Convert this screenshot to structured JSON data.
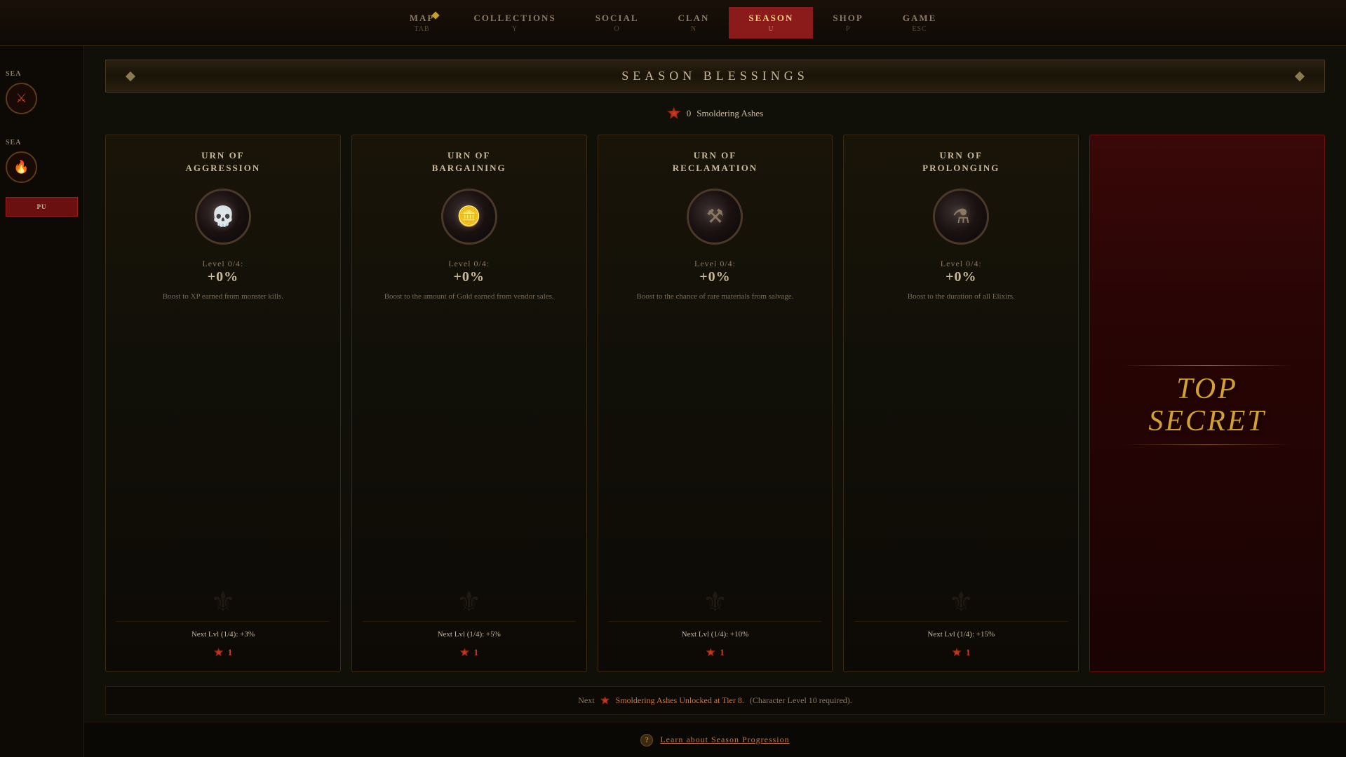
{
  "nav": {
    "items": [
      {
        "id": "map",
        "label": "MAP",
        "key": "TAB",
        "active": false,
        "hasDiamond": true
      },
      {
        "id": "collections",
        "label": "COLLECTIONS",
        "key": "Y",
        "active": false,
        "hasDiamond": false
      },
      {
        "id": "social",
        "label": "SOCIAL",
        "key": "O",
        "active": false,
        "hasDiamond": false
      },
      {
        "id": "clan",
        "label": "CLAN",
        "key": "N",
        "active": false,
        "hasDiamond": false
      },
      {
        "id": "season",
        "label": "SEASON",
        "key": "U",
        "active": true,
        "hasDiamond": false
      },
      {
        "id": "shop",
        "label": "SHOP",
        "key": "P",
        "active": false,
        "hasDiamond": false
      },
      {
        "id": "game",
        "label": "GAME",
        "key": "ESC",
        "active": false,
        "hasDiamond": false
      }
    ]
  },
  "panel": {
    "title": "SEASON BLESSINGS",
    "ashes_count": "0",
    "ashes_label": "Smoldering Ashes"
  },
  "sidebar": {
    "items": [
      {
        "label": "SEA",
        "icon": "⚔"
      },
      {
        "label": "SEA",
        "icon": "🔥"
      }
    ],
    "button_label": "PU"
  },
  "blessings": [
    {
      "id": "aggression",
      "title_line1": "URN OF",
      "title_line2": "AGGRESSION",
      "icon": "💀",
      "level_text": "Level 0/4:",
      "level_bonus": "+0%",
      "description": "Boost to XP earned from monster kills.",
      "next_lvl_text": "Next Lvl (1/4): +3%",
      "cost": "1",
      "type": "normal"
    },
    {
      "id": "bargaining",
      "title_line1": "URN OF",
      "title_line2": "BARGAINING",
      "icon": "🪙",
      "level_text": "Level 0/4:",
      "level_bonus": "+0%",
      "description": "Boost to the amount of Gold earned from vendor sales.",
      "next_lvl_text": "Next Lvl (1/4): +5%",
      "cost": "1",
      "type": "normal"
    },
    {
      "id": "reclamation",
      "title_line1": "URN OF",
      "title_line2": "RECLAMATION",
      "icon": "⚒",
      "level_text": "Level 0/4:",
      "level_bonus": "+0%",
      "description": "Boost to the chance of rare materials from salvage.",
      "next_lvl_text": "Next Lvl (1/4): +10%",
      "cost": "1",
      "type": "normal"
    },
    {
      "id": "prolonging",
      "title_line1": "URN OF",
      "title_line2": "PROLONGING",
      "icon": "⚗",
      "level_text": "Level 0/4:",
      "level_bonus": "+0%",
      "description": "Boost to the duration of all Elixirs.",
      "next_lvl_text": "Next Lvl (1/4): +15%",
      "cost": "1",
      "type": "normal"
    },
    {
      "id": "top-secret",
      "title_line1": "TOP",
      "title_line2": "SECRET",
      "type": "secret"
    }
  ],
  "bottom_info": {
    "prefix": "Next",
    "highlight": "Smoldering Ashes Unlocked at Tier 8.",
    "suffix": " (Character Level 10 required)."
  },
  "footer": {
    "help_text": "Learn about Season Progression"
  },
  "icons": {
    "back": "↩",
    "question": "?",
    "ashes_symbol": "🔥"
  }
}
